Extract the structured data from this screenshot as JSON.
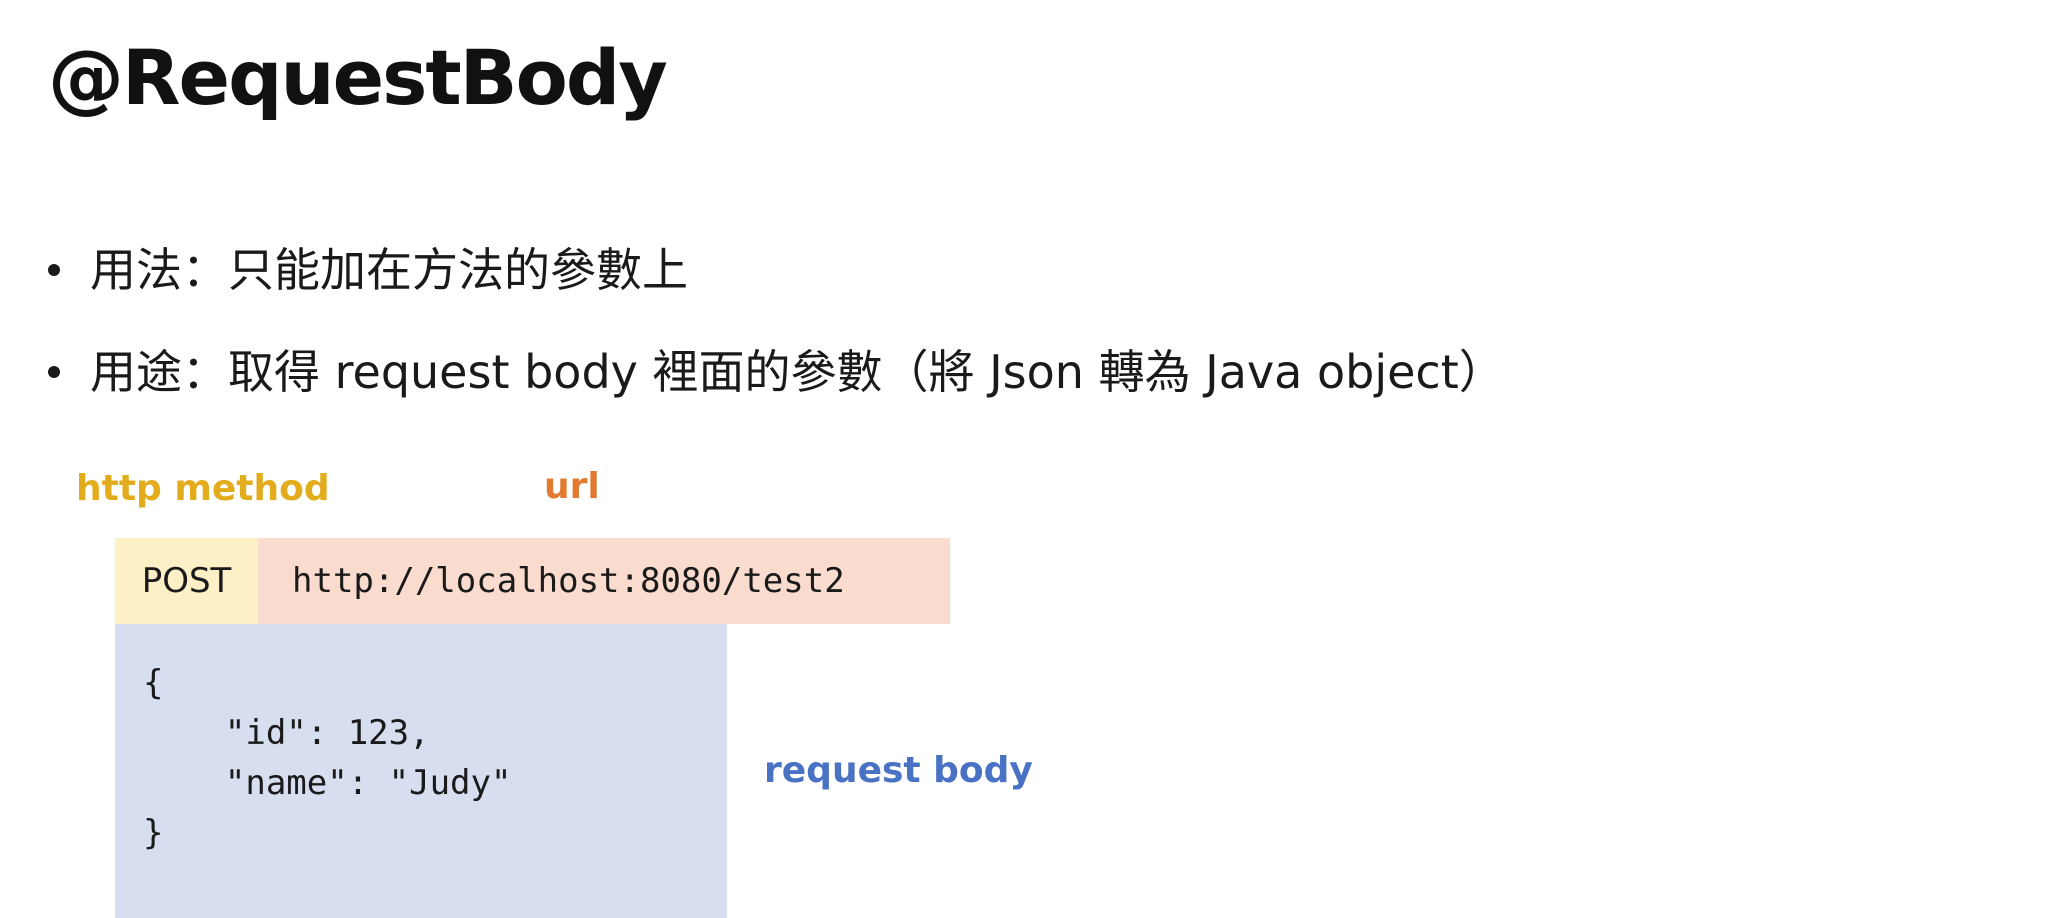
{
  "slide": {
    "title": "@RequestBody",
    "bullets": [
      {
        "text": "用法：只能加在方法的參數上"
      },
      {
        "text": "用途：取得 request body 裡面的參數（將 Json 轉為 Java object）"
      }
    ]
  },
  "diagram": {
    "labels": {
      "method": "http method",
      "url": "url",
      "body": "request body"
    },
    "request": {
      "method": "POST",
      "url": "http://localhost:8080/test2",
      "body_lines": [
        "{",
        "    \"id\": 123,",
        "    \"name\": \"Judy\"",
        "}"
      ]
    },
    "colors": {
      "method_label": "#e3ac1d",
      "url_label": "#e07b2f",
      "body_label": "#4a72c4",
      "method_box": "#fdf0c6",
      "url_box": "#f9dccd",
      "body_box": "#d6deef"
    }
  }
}
